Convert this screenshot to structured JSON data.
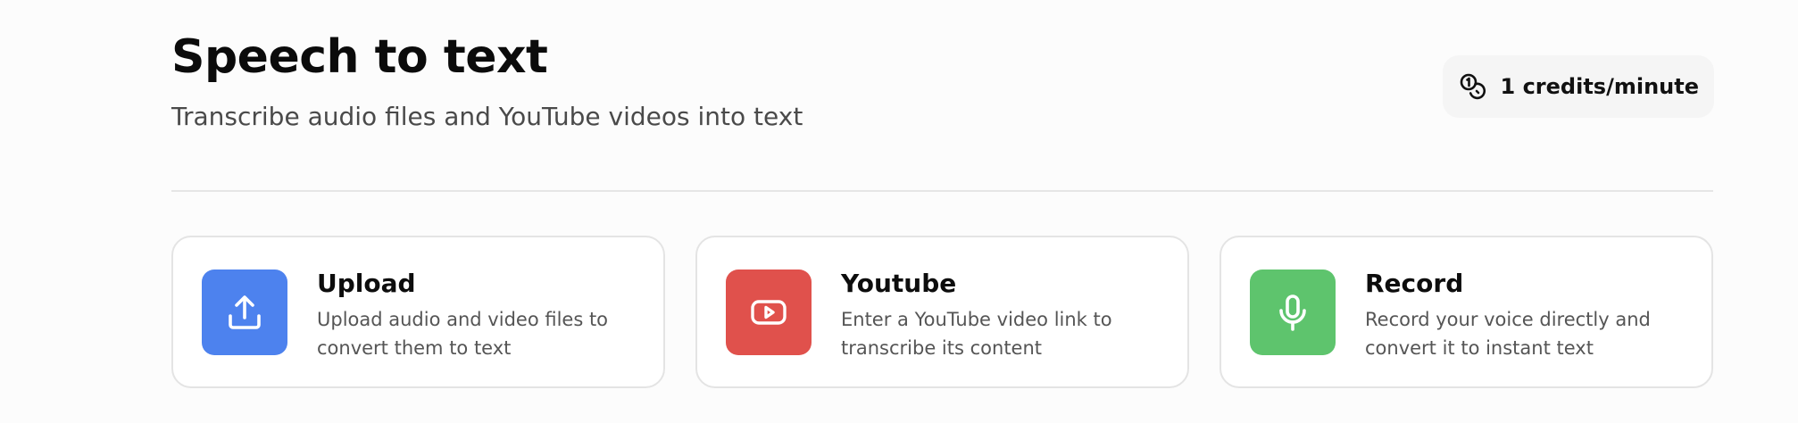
{
  "header": {
    "title": "Speech to text",
    "subtitle": "Transcribe audio files and YouTube videos into text"
  },
  "credits": {
    "icon": "coins-icon",
    "label": "1 credits/minute"
  },
  "cards": [
    {
      "title": "Upload",
      "description": "Upload audio and video files to convert them to text",
      "icon": "upload-icon",
      "color": "#4d82ee"
    },
    {
      "title": "Youtube",
      "description": "Enter a YouTube video link to transcribe its content",
      "icon": "youtube-icon",
      "color": "#e0514c"
    },
    {
      "title": "Record",
      "description": "Record your voice directly and convert it to instant text",
      "icon": "microphone-icon",
      "color": "#5ec46d"
    }
  ]
}
